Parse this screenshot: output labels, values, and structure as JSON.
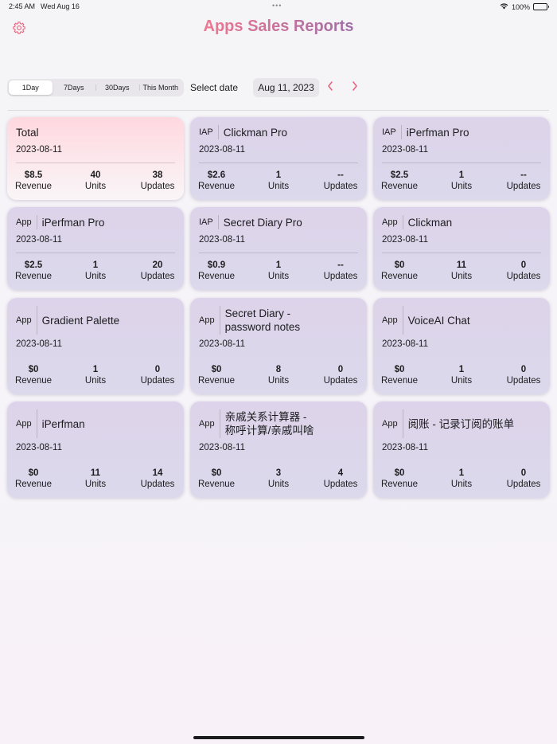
{
  "status": {
    "time": "2:45 AM",
    "date": "Wed Aug 16",
    "battery": "100%",
    "dots": "•••"
  },
  "header": {
    "title": "Apps Sales Reports"
  },
  "toolbar": {
    "segments": [
      "1Day",
      "7Days",
      "30Days",
      "This Month"
    ],
    "selected_segment": "1Day",
    "select_date_label": "Select date",
    "date_value": "Aug 11, 2023",
    "prev": "‹",
    "next": "›"
  },
  "labels": {
    "revenue": "Revenue",
    "units": "Units",
    "updates": "Updates"
  },
  "cards": [
    {
      "type": "",
      "name": "Total",
      "date": "2023-08-11",
      "revenue": "$8.5",
      "units": "40",
      "updates": "38"
    },
    {
      "type": "IAP",
      "name": "Clickman Pro",
      "date": "2023-08-11",
      "revenue": "$2.6",
      "units": "1",
      "updates": "--"
    },
    {
      "type": "IAP",
      "name": "iPerfman Pro",
      "date": "2023-08-11",
      "revenue": "$2.5",
      "units": "1",
      "updates": "--"
    },
    {
      "type": "App",
      "name": "iPerfman Pro",
      "date": "2023-08-11",
      "revenue": "$2.5",
      "units": "1",
      "updates": "20"
    },
    {
      "type": "IAP",
      "name": "Secret Diary Pro",
      "date": "2023-08-11",
      "revenue": "$0.9",
      "units": "1",
      "updates": "--"
    },
    {
      "type": "App",
      "name": "Clickman",
      "date": "2023-08-11",
      "revenue": "$0",
      "units": "11",
      "updates": "0"
    },
    {
      "type": "App",
      "name": "Gradient Palette",
      "date": "2023-08-11",
      "revenue": "$0",
      "units": "1",
      "updates": "0"
    },
    {
      "type": "App",
      "name": "Secret Diary -\n password notes",
      "date": "2023-08-11",
      "revenue": "$0",
      "units": "8",
      "updates": "0"
    },
    {
      "type": "App",
      "name": "VoiceAI Chat",
      "date": "2023-08-11",
      "revenue": "$0",
      "units": "1",
      "updates": "0"
    },
    {
      "type": "App",
      "name": "iPerfman",
      "date": "2023-08-11",
      "revenue": "$0",
      "units": "11",
      "updates": "14"
    },
    {
      "type": "App",
      "name": "亲戚关系计算器 -\n 称呼计算/亲戚叫啥",
      "date": "2023-08-11",
      "revenue": "$0",
      "units": "3",
      "updates": "4"
    },
    {
      "type": "App",
      "name": "阅账 - 记录订阅的账单",
      "date": "2023-08-11",
      "revenue": "$0",
      "units": "1",
      "updates": "0"
    }
  ],
  "colors": {
    "accent": "#e9657f",
    "title_start": "#ef7790",
    "title_end": "#a06fa7",
    "card_bg": "#ddd6eb",
    "total_card_bg": "#ffd8df"
  },
  "icons": {
    "settings": "gear-icon",
    "prev": "chevron-left-icon",
    "next": "chevron-right-icon",
    "wifi": "wifi-icon",
    "battery": "battery-icon"
  }
}
